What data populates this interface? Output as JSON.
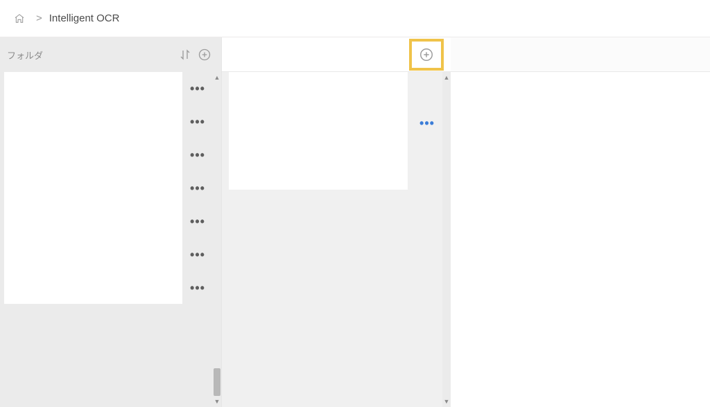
{
  "breadcrumb": {
    "home_label": "Home",
    "title": "Intelligent OCR"
  },
  "folders": {
    "title": "フォルダ",
    "sort_label": "Sort",
    "add_label": "Add Folder",
    "item_count": 7,
    "action_label": "More"
  },
  "documents": {
    "add_label": "Add Document",
    "action_label": "More"
  }
}
